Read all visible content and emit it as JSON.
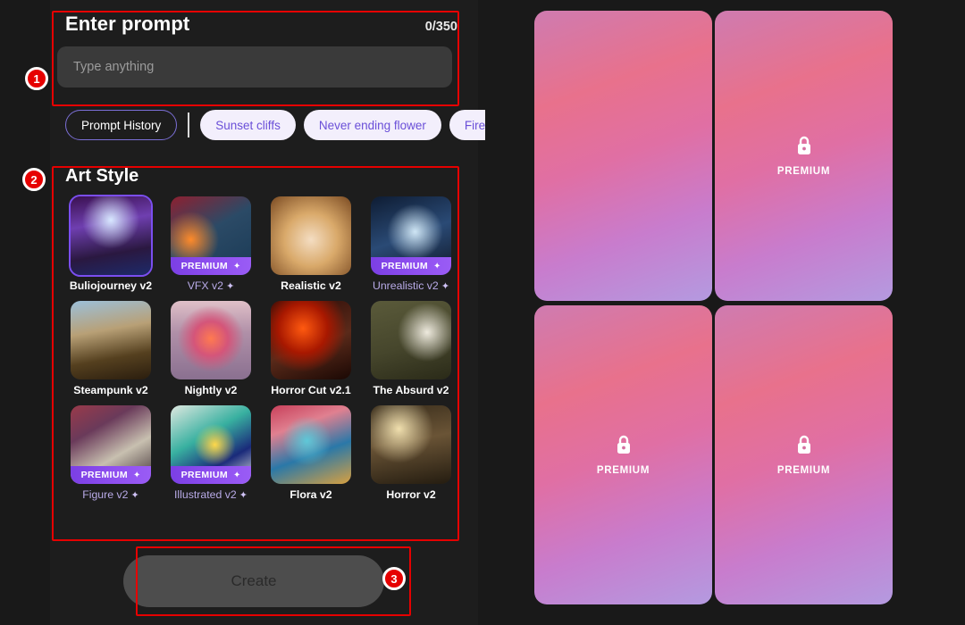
{
  "app": {
    "background_color": "#191919",
    "panel_color": "#1d1d1d",
    "accent_purple": "#7b4ef0",
    "annotation_color": "#e60000"
  },
  "prompt": {
    "title": "Enter prompt",
    "counter": "0/350",
    "input_value": "",
    "placeholder": "Type anything"
  },
  "chips": {
    "history_label": "Prompt History",
    "suggestions": [
      {
        "label": "Sunset cliffs"
      },
      {
        "label": "Never ending flower"
      },
      {
        "label": "Fire and w"
      }
    ]
  },
  "art_style": {
    "title": "Art Style",
    "items": [
      {
        "label": "Buliojourney v2",
        "premium": false,
        "selected": true,
        "star": false,
        "badge_label": "",
        "badge_star": ""
      },
      {
        "label": "VFX v2",
        "premium": true,
        "selected": false,
        "star": true,
        "badge_label": "PREMIUM",
        "badge_star": "✦"
      },
      {
        "label": "Realistic v2",
        "premium": false,
        "selected": false,
        "star": false,
        "badge_label": "",
        "badge_star": ""
      },
      {
        "label": "Unrealistic v2",
        "premium": true,
        "selected": false,
        "star": true,
        "badge_label": "PREMIUM",
        "badge_star": "✦"
      },
      {
        "label": "Steampunk v2",
        "premium": false,
        "selected": false,
        "star": false,
        "badge_label": "",
        "badge_star": ""
      },
      {
        "label": "Nightly v2",
        "premium": false,
        "selected": false,
        "star": false,
        "badge_label": "",
        "badge_star": ""
      },
      {
        "label": "Horror Cut v2.1",
        "premium": false,
        "selected": false,
        "star": false,
        "badge_label": "",
        "badge_star": ""
      },
      {
        "label": "The Absurd v2",
        "premium": false,
        "selected": false,
        "star": false,
        "badge_label": "",
        "badge_star": ""
      },
      {
        "label": "Figure v2",
        "premium": true,
        "selected": false,
        "star": true,
        "badge_label": "PREMIUM",
        "badge_star": "✦"
      },
      {
        "label": "Illustrated v2",
        "premium": true,
        "selected": false,
        "star": true,
        "badge_label": "PREMIUM",
        "badge_star": "✦"
      },
      {
        "label": "Flora v2",
        "premium": false,
        "selected": false,
        "star": false,
        "badge_label": "",
        "badge_star": ""
      },
      {
        "label": "Horror v2",
        "premium": false,
        "selected": false,
        "star": false,
        "badge_label": "",
        "badge_star": ""
      }
    ]
  },
  "create": {
    "label": "Create"
  },
  "gallery": {
    "cards": [
      {
        "premium_label": "",
        "locked": false
      },
      {
        "premium_label": "PREMIUM",
        "locked": true
      },
      {
        "premium_label": "PREMIUM",
        "locked": true
      },
      {
        "premium_label": "PREMIUM",
        "locked": true
      }
    ]
  },
  "annotations": [
    {
      "number": "1"
    },
    {
      "number": "2"
    },
    {
      "number": "3"
    }
  ]
}
